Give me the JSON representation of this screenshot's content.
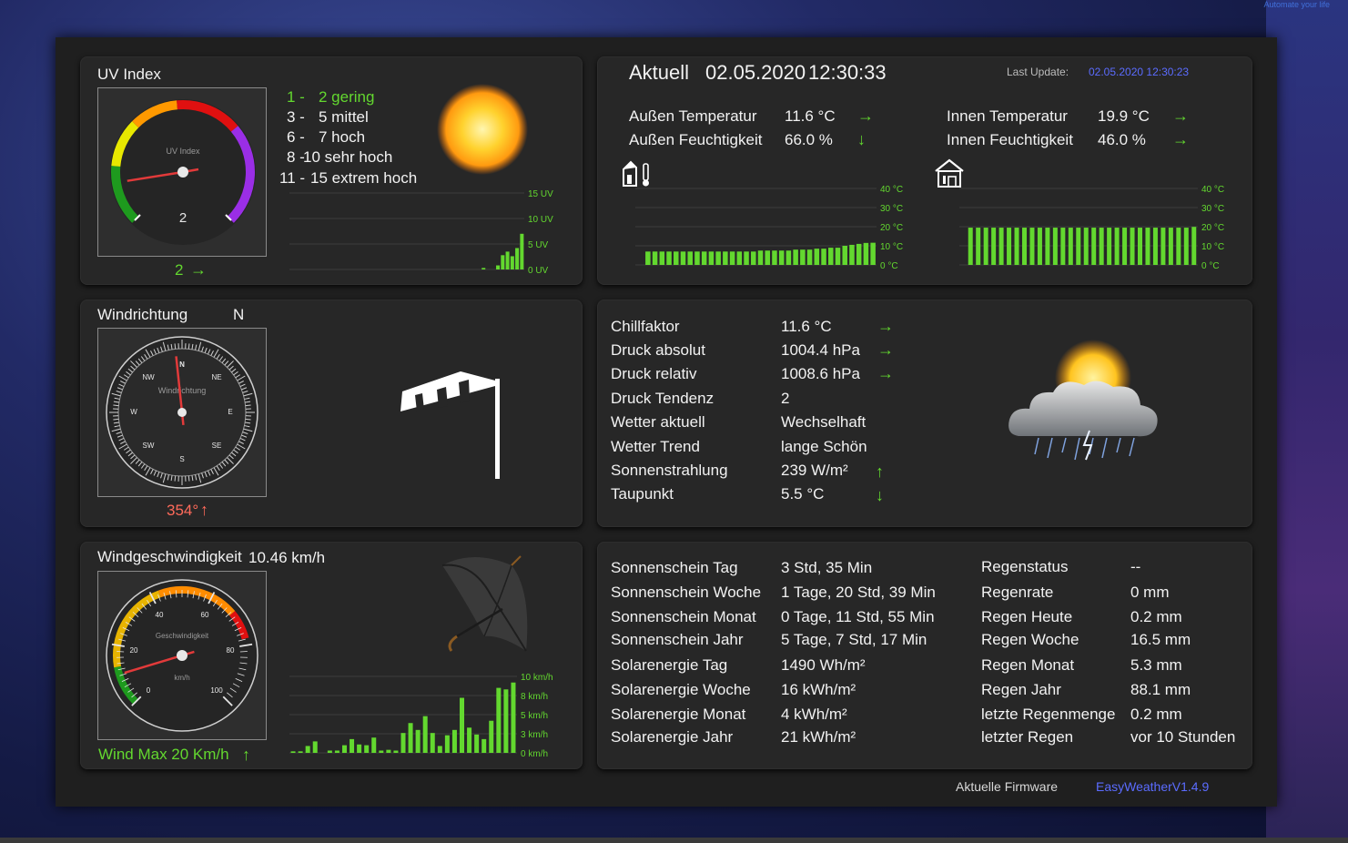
{
  "app": {
    "firmware_label": "Aktuelle Firmware",
    "firmware_value": "EasyWeatherV1.4.9",
    "logo_text": "Automate your life"
  },
  "colors": {
    "accent_green": "#63d82f",
    "link_blue": "#5b6cff",
    "wind_red": "#ff6a5a",
    "panel": "#272727"
  },
  "uv": {
    "title": "UV Index",
    "gauge_label": "UV Index",
    "gauge_value": "2",
    "value": 2,
    "value_display": "2",
    "trend": "→",
    "legend": [
      {
        "range": "1  -",
        "text": "2 gering"
      },
      {
        "range": "3  -",
        "text": "5 mittel"
      },
      {
        "range": "6  -",
        "text": "7 hoch"
      },
      {
        "range": "8  -",
        "text": "10 sehr hoch"
      },
      {
        "range": "11  -",
        "text": "15 extrem hoch"
      }
    ]
  },
  "current": {
    "title": "Aktuell",
    "date": "02.05.2020",
    "time": "12:30:33",
    "last_update_label": "Last Update:",
    "last_update_value": "02.05.2020 12:30:23",
    "outside": [
      {
        "label": "Außen Temperatur",
        "value": "11.6 °C",
        "trend": "→"
      },
      {
        "label": "Außen Feuchtigkeit",
        "value": "66.0 %",
        "trend": "↓"
      }
    ],
    "inside": [
      {
        "label": "Innen Temperatur",
        "value": "19.9 °C",
        "trend": "→"
      },
      {
        "label": "Innen Feuchtigkeit",
        "value": "46.0 %",
        "trend": "→"
      }
    ]
  },
  "wind_dir": {
    "title": "Windrichtung",
    "direction": "N",
    "gauge_label": "Windrichtung",
    "degrees": 354,
    "value_display": "354°",
    "trend": "↑",
    "compass": {
      "n": "N",
      "ne": "NE",
      "e": "E",
      "se": "SE",
      "s": "S",
      "sw": "SW",
      "w": "W",
      "nw": "NW"
    }
  },
  "details": [
    {
      "label": "Chillfaktor",
      "value": "11.6 °C",
      "trend": "→"
    },
    {
      "label": "Druck absolut",
      "value": "1004.4 hPa",
      "trend": "→"
    },
    {
      "label": "Druck relativ",
      "value": "1008.6 hPa",
      "trend": "→"
    },
    {
      "label": "Druck Tendenz",
      "value": "2",
      "trend": ""
    },
    {
      "label": "Wetter aktuell",
      "value": "Wechselhaft",
      "trend": ""
    },
    {
      "label": "Wetter Trend",
      "value": "lange Schön",
      "trend": ""
    },
    {
      "label": "Sonnenstrahlung",
      "value": "239 W/m²",
      "trend": "↑"
    },
    {
      "label": "Taupunkt",
      "value": "5.5 °C",
      "trend": "↓"
    }
  ],
  "wind_speed": {
    "title": "Windgeschwindigkeit",
    "value_display": "10.46 km/h",
    "value": 10.46,
    "gauge_label": "Geschwindigkeit",
    "unit": "km/h",
    "gauge_ticks": [
      "0",
      "20",
      "40",
      "60",
      "80",
      "100"
    ],
    "max_label": "Wind Max 20 Km/h",
    "max_trend": "↑"
  },
  "sun_stats": [
    {
      "label": "Sonnenschein Tag",
      "value": "3 Std, 35 Min"
    },
    {
      "label": "Sonnenschein Woche",
      "value": "1 Tage, 20 Std, 39 Min"
    },
    {
      "label": "Sonnenschein Monat",
      "value": "0 Tage, 11 Std, 55 Min"
    },
    {
      "label": "Sonnenschein Jahr",
      "value": "5 Tage, 7 Std, 17 Min"
    },
    {
      "label": "Solarenergie Tag",
      "value": "1490 Wh/m²"
    },
    {
      "label": "Solarenergie Woche",
      "value": "16 kWh/m²"
    },
    {
      "label": "Solarenergie Monat",
      "value": "4 kWh/m²"
    },
    {
      "label": "Solarenergie Jahr",
      "value": "21 kWh/m²"
    }
  ],
  "rain_stats": [
    {
      "label": "Regenstatus",
      "value": "--"
    },
    {
      "label": "Regenrate",
      "value": "0 mm"
    },
    {
      "label": "Regen Heute",
      "value": "0.2 mm"
    },
    {
      "label": "Regen Woche",
      "value": "16.5 mm"
    },
    {
      "label": "Regen Monat",
      "value": "5.3 mm"
    },
    {
      "label": "Regen Jahr",
      "value": "88.1 mm"
    },
    {
      "label": "letzte Regenmenge",
      "value": "0.2 mm"
    },
    {
      "label": "letzter Regen",
      "value": "vor 10 Stunden"
    }
  ],
  "chart_data": [
    {
      "type": "bar",
      "id": "uv",
      "ylim": [
        0,
        15
      ],
      "ticks": [
        "15 UV",
        "10 UV",
        "5 UV",
        "0 UV"
      ],
      "values": [
        0,
        0,
        0,
        0,
        0,
        0,
        0,
        0,
        0,
        0,
        0,
        0,
        0,
        0,
        0,
        0,
        0,
        0,
        0,
        0,
        0,
        0,
        0,
        0,
        0,
        0,
        0,
        0,
        0,
        0,
        0,
        0,
        0,
        0,
        0,
        0,
        0,
        0,
        0,
        0,
        0.3,
        0,
        0,
        0.8,
        2.8,
        3.5,
        2.6,
        4.2,
        7
      ]
    },
    {
      "type": "bar",
      "id": "outside_temp",
      "ylim": [
        0,
        40
      ],
      "ticks": [
        "40 °C",
        "30 °C",
        "20 °C",
        "10 °C",
        "0 °C"
      ],
      "values": [
        7,
        7,
        7,
        7,
        7,
        7,
        7,
        7,
        7,
        7,
        7,
        7,
        7,
        7,
        7,
        7,
        7.5,
        7.5,
        7.5,
        7.5,
        7.5,
        8,
        8,
        8,
        8.5,
        8.5,
        9,
        9,
        10,
        10.5,
        11,
        11.5,
        11.6
      ]
    },
    {
      "type": "bar",
      "id": "inside_temp",
      "ylim": [
        0,
        40
      ],
      "ticks": [
        "40 °C",
        "30 °C",
        "20 °C",
        "10 °C",
        "0 °C"
      ],
      "values": [
        19.5,
        19.5,
        19.5,
        19.5,
        19.5,
        19.5,
        19.5,
        19.5,
        19.5,
        19.5,
        19.5,
        19.5,
        19.5,
        19.5,
        19.5,
        19.5,
        19.5,
        19.5,
        19.5,
        19.5,
        19.5,
        19.5,
        19.5,
        19.5,
        19.5,
        19.5,
        19.5,
        19.5,
        19.5,
        19.9
      ]
    },
    {
      "type": "bar",
      "id": "wind_speed",
      "ylim": [
        0,
        10
      ],
      "ticks": [
        "10 km/h",
        "8 km/h",
        "5 km/h",
        "3 km/h",
        "0 km/h"
      ],
      "values": [
        0.2,
        0.2,
        0.9,
        1.5,
        0,
        0.3,
        0.3,
        1.0,
        1.8,
        1.1,
        1.0,
        2.0,
        0.3,
        0.4,
        0.3,
        2.6,
        3.9,
        3.0,
        4.8,
        2.6,
        0.9,
        2.3,
        3.0,
        7.2,
        3.3,
        2.4,
        1.8,
        4.2,
        8.5,
        8.3,
        9.2
      ]
    }
  ]
}
